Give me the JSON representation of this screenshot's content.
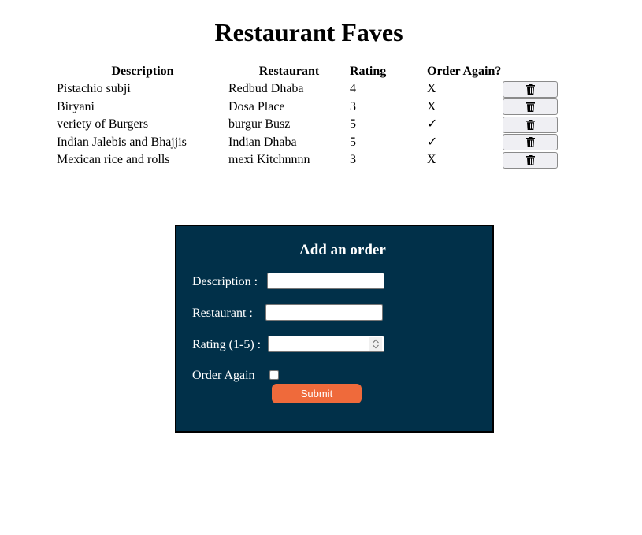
{
  "page": {
    "title": "Restaurant Faves"
  },
  "table": {
    "headers": {
      "description": "Description",
      "restaurant": "Restaurant",
      "rating": "Rating",
      "order_again": "Order Again?"
    },
    "delete_icon": "trash-icon",
    "rows": [
      {
        "description": "Pistachio subji",
        "restaurant": "Redbud Dhaba",
        "rating": "4",
        "order_again": "X"
      },
      {
        "description": "Biryani",
        "restaurant": "Dosa Place",
        "rating": "3",
        "order_again": "X"
      },
      {
        "description": "veriety of Burgers",
        "restaurant": "burgur Busz",
        "rating": "5",
        "order_again": "✓"
      },
      {
        "description": "Indian Jalebis and Bhajjis",
        "restaurant": "Indian Dhaba",
        "rating": "5",
        "order_again": "✓"
      },
      {
        "description": "Mexican rice and rolls",
        "restaurant": "mexi Kitchnnnn",
        "rating": "3",
        "order_again": "X"
      }
    ]
  },
  "form": {
    "title": "Add an order",
    "description_label": "Description :",
    "description_value": "",
    "restaurant_label": "Restaurant :",
    "restaurant_value": "",
    "rating_label": "Rating (1-5) :",
    "rating_value": "",
    "order_again_label": "Order Again",
    "order_again_checked": false,
    "submit_label": "Submit"
  },
  "colors": {
    "panel_bg": "#013049",
    "submit_bg": "#ef6a3b",
    "delete_btn_bg": "#efeff3"
  }
}
